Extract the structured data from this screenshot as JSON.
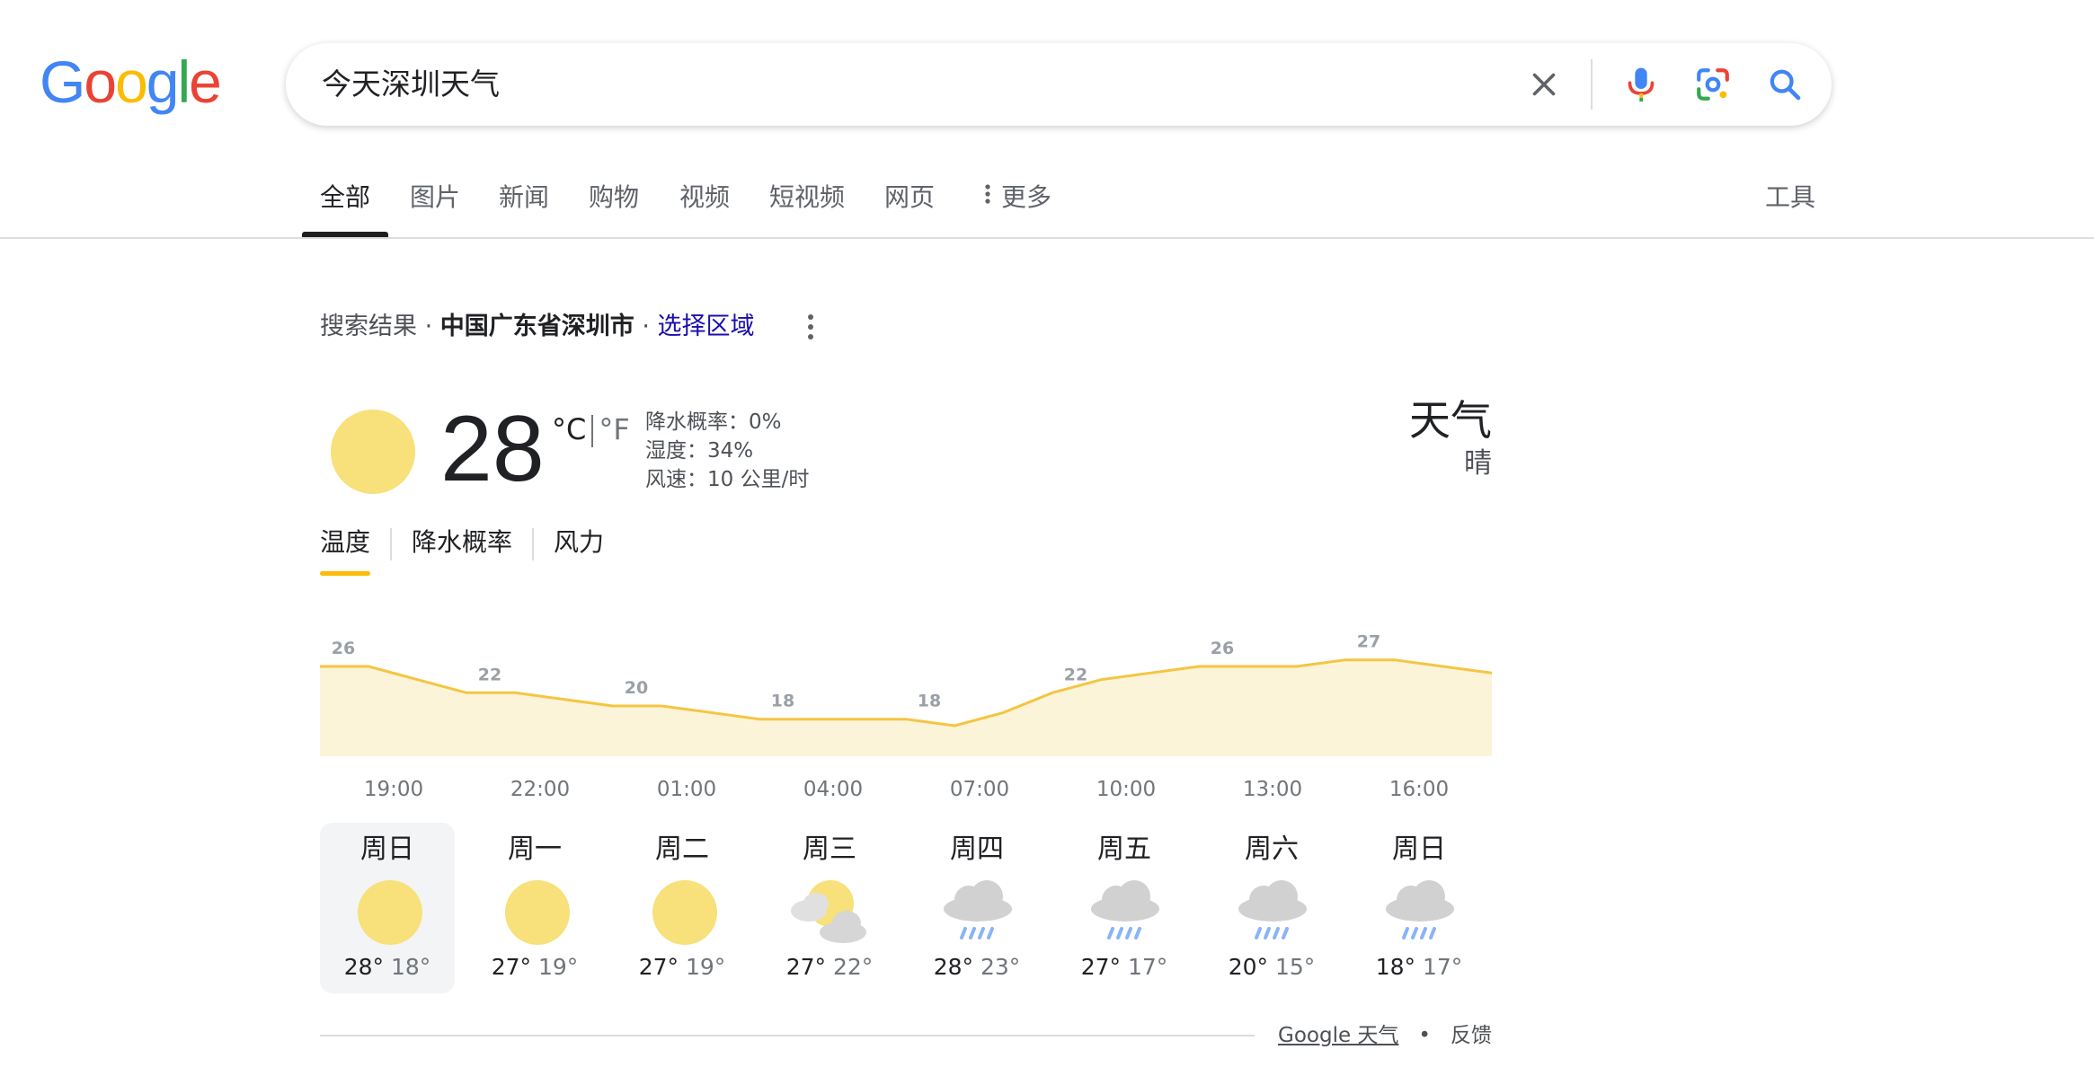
{
  "logo": {
    "letters": [
      {
        "ch": "G",
        "color": "#4285F4"
      },
      {
        "ch": "o",
        "color": "#EA4335"
      },
      {
        "ch": "o",
        "color": "#FBBC05"
      },
      {
        "ch": "g",
        "color": "#4285F4"
      },
      {
        "ch": "l",
        "color": "#34A853"
      },
      {
        "ch": "e",
        "color": "#EA4335"
      }
    ]
  },
  "search": {
    "query": "今天深圳天气",
    "icons": [
      "close-icon",
      "microphone-icon",
      "camera-lens-icon",
      "search-icon"
    ]
  },
  "tabs": {
    "items": [
      "全部",
      "图片",
      "新闻",
      "购物",
      "视频",
      "短视频",
      "网页"
    ],
    "more": "更多",
    "tools": "工具",
    "active": "全部"
  },
  "meta": {
    "prefix": "搜索结果 · ",
    "location": "中国广东省深圳市",
    "sep": " · ",
    "choose_region": "选择区域"
  },
  "current": {
    "temperature": "28",
    "unit_c": "°C",
    "unit_f": "°F",
    "precip": "降水概率：0%",
    "humidity": "湿度：34%",
    "wind": "风速：10 公里/时",
    "title": "天气",
    "condition": "晴"
  },
  "subtabs": {
    "temperature": "温度",
    "precip": "降水概率",
    "wind": "风力",
    "active": "温度"
  },
  "chart_data": {
    "type": "area",
    "x": [
      "19:00",
      "20:00",
      "21:00",
      "22:00",
      "23:00",
      "00:00",
      "01:00",
      "02:00",
      "03:00",
      "04:00",
      "05:00",
      "06:00",
      "07:00",
      "08:00",
      "09:00",
      "10:00",
      "11:00",
      "12:00",
      "13:00",
      "14:00",
      "15:00",
      "16:00",
      "17:00",
      "18:00",
      "19:00"
    ],
    "values": [
      26,
      26,
      24,
      22,
      22,
      21,
      20,
      20,
      19,
      18,
      18,
      18,
      18,
      17,
      19,
      22,
      24,
      25,
      26,
      26,
      26,
      27,
      27,
      26,
      25
    ],
    "labels": [
      {
        "index": 0,
        "text": "26"
      },
      {
        "index": 3,
        "text": "22"
      },
      {
        "index": 6,
        "text": "20"
      },
      {
        "index": 9,
        "text": "18"
      },
      {
        "index": 12,
        "text": "18"
      },
      {
        "index": 15,
        "text": "22"
      },
      {
        "index": 18,
        "text": "26"
      },
      {
        "index": 21,
        "text": "27"
      }
    ],
    "tick_labels": [
      "19:00",
      "22:00",
      "01:00",
      "04:00",
      "07:00",
      "10:00",
      "13:00",
      "16:00"
    ],
    "line_color": "#F5C542",
    "fill_color": "#FCF4D8"
  },
  "forecast": [
    {
      "day": "周日",
      "icon": "sun-icon",
      "hi": "28°",
      "lo": "18°",
      "selected": true
    },
    {
      "day": "周一",
      "icon": "sun-icon",
      "hi": "27°",
      "lo": "19°",
      "selected": false
    },
    {
      "day": "周二",
      "icon": "sun-icon",
      "hi": "27°",
      "lo": "19°",
      "selected": false
    },
    {
      "day": "周三",
      "icon": "partly-cloudy-icon",
      "hi": "27°",
      "lo": "22°",
      "selected": false
    },
    {
      "day": "周四",
      "icon": "rain-cloud-icon",
      "hi": "28°",
      "lo": "23°",
      "selected": false
    },
    {
      "day": "周五",
      "icon": "rain-cloud-icon",
      "hi": "27°",
      "lo": "17°",
      "selected": false
    },
    {
      "day": "周六",
      "icon": "rain-cloud-icon",
      "hi": "20°",
      "lo": "15°",
      "selected": false
    },
    {
      "day": "周日",
      "icon": "rain-cloud-icon",
      "hi": "18°",
      "lo": "17°",
      "selected": false
    }
  ],
  "footer": {
    "source": "Google 天气",
    "dot": "•",
    "feedback": "反馈"
  }
}
